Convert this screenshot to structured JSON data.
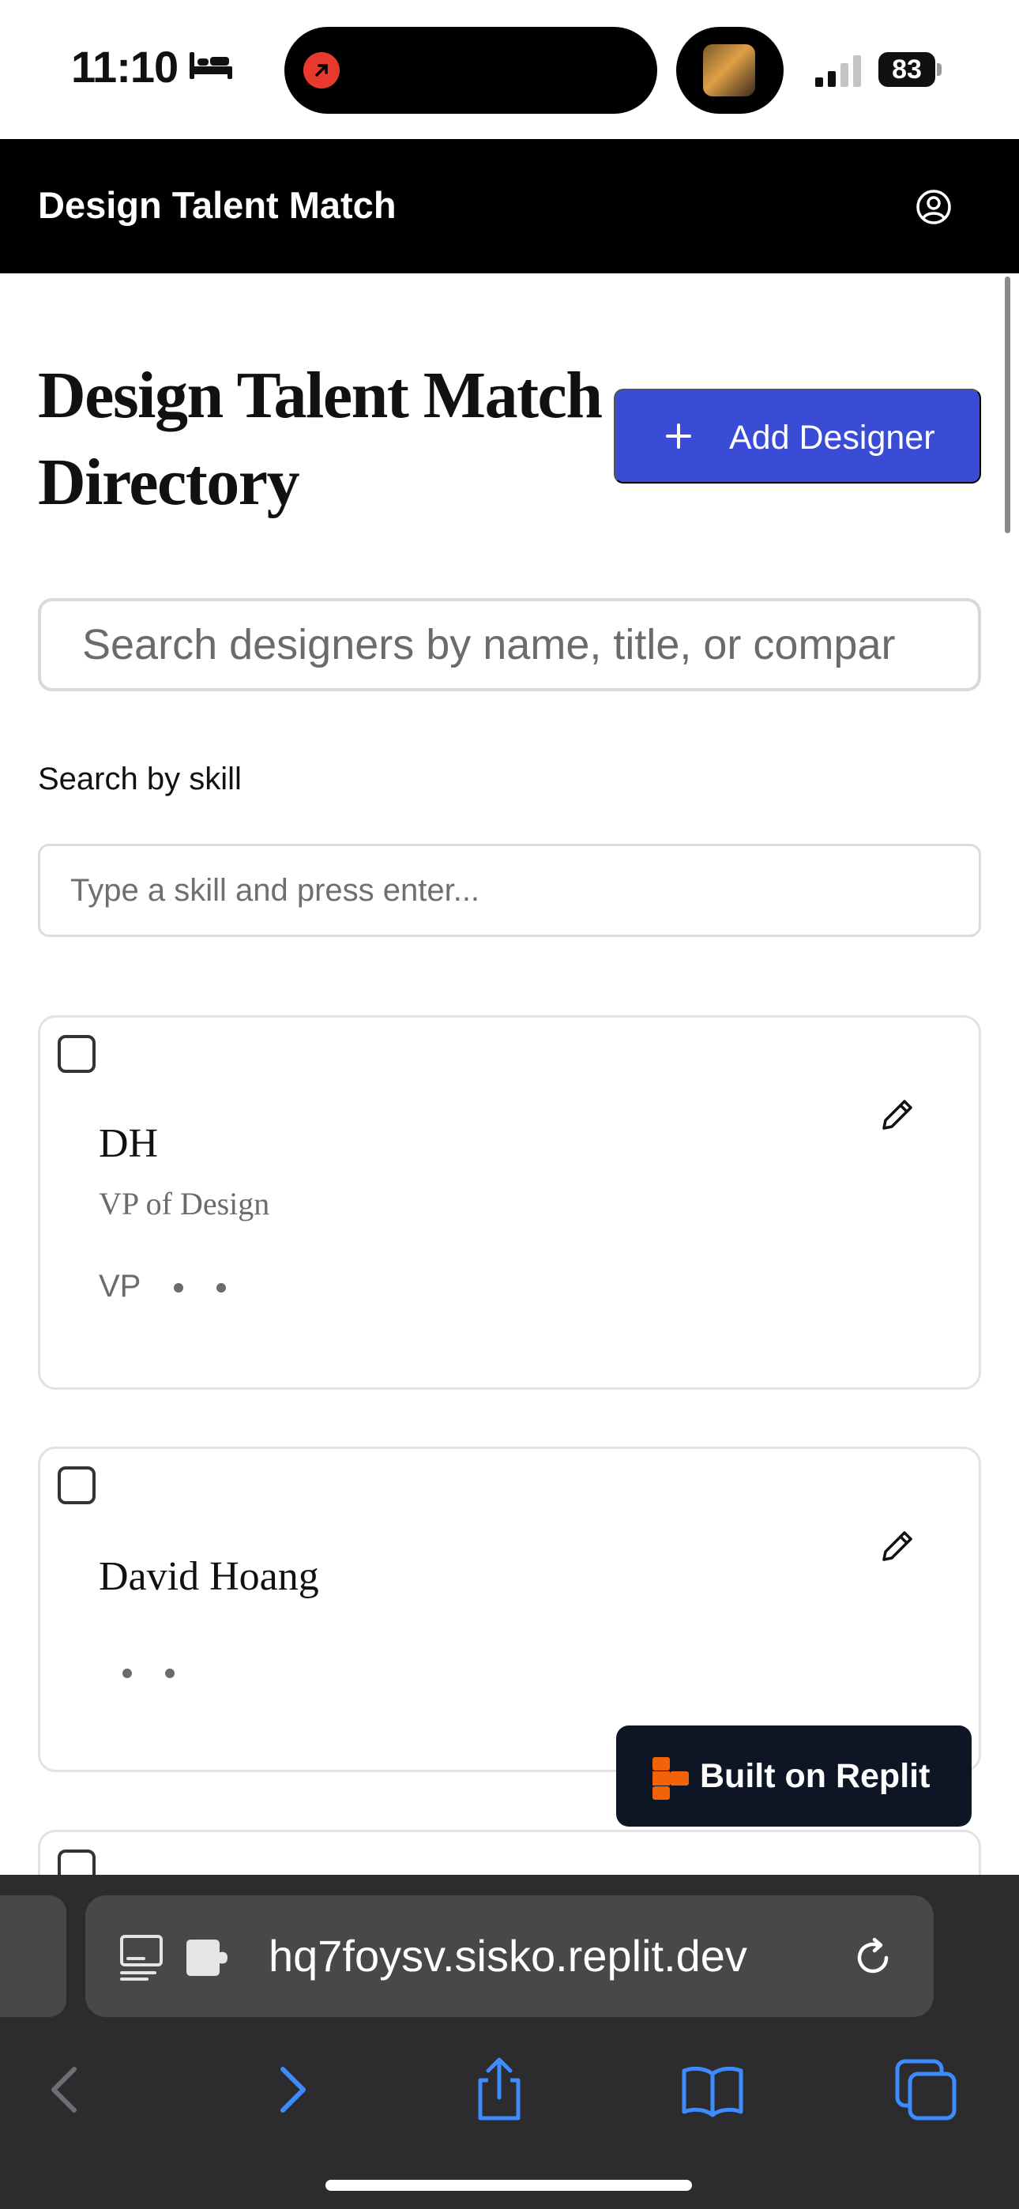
{
  "status_bar": {
    "time": "11:10",
    "battery": "83",
    "icons": [
      "bed-icon",
      "live-activity-icon",
      "now-playing-artwork",
      "signal-icon",
      "battery-icon"
    ]
  },
  "header": {
    "title": "Design Talent Match",
    "account_icon": "account-circle-icon"
  },
  "page": {
    "title": "Design Talent Match Directory",
    "add_button": "Add Designer"
  },
  "search": {
    "placeholder": "Search designers by name, title, or compar",
    "skill_label": "Search by skill",
    "skill_placeholder": "Type a skill and press enter..."
  },
  "designers": [
    {
      "name": "DH",
      "title": "VP of Design",
      "meta": "VP"
    },
    {
      "name": "David Hoang",
      "title": "",
      "meta": ""
    }
  ],
  "badge": {
    "label": "Built on Replit"
  },
  "browser": {
    "url": "hq7foysv.sisko.replit.dev",
    "icons": [
      "back-icon",
      "forward-icon",
      "share-icon",
      "bookmarks-icon",
      "tabs-icon"
    ]
  },
  "colors": {
    "primary": "#3a4bd6",
    "header_bg": "#000000",
    "badge_bg": "#0e1525",
    "replit_orange": "#f26207",
    "safari_bg": "#2c2c2e"
  }
}
